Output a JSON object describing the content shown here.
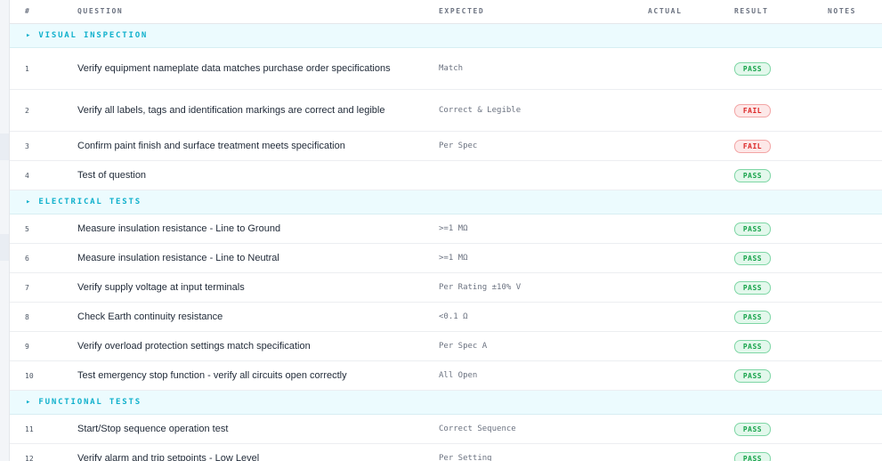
{
  "columns": {
    "num": "#",
    "question": "QUESTION",
    "expected": "EXPECTED",
    "actual": "ACTUAL",
    "result": "RESULT",
    "notes": "NOTES"
  },
  "colors": {
    "section_bg": "#ecfbfe",
    "section_text": "#0fb0cc",
    "pass": "#16a34a",
    "fail": "#dc2626"
  },
  "sections": [
    {
      "title": "▸ VISUAL INSPECTION",
      "rows": [
        {
          "num": "1",
          "question": "Verify equipment nameplate data matches purchase order specifications",
          "expected": "Match",
          "actual": "",
          "result": "PASS",
          "status": "pass",
          "notes": ""
        },
        {
          "num": "2",
          "question": "Verify all labels, tags and identification markings are correct and legible",
          "expected": "Correct & Legible",
          "actual": "",
          "result": "FAIL",
          "status": "fail",
          "notes": ""
        },
        {
          "num": "3",
          "question": "Confirm paint finish and surface treatment meets specification",
          "expected": "Per Spec",
          "actual": "",
          "result": "FAIL",
          "status": "fail",
          "notes": ""
        },
        {
          "num": "4",
          "question": "Test of question",
          "expected": "",
          "actual": "",
          "result": "PASS",
          "status": "pass",
          "notes": ""
        }
      ]
    },
    {
      "title": "▸ ELECTRICAL TESTS",
      "rows": [
        {
          "num": "5",
          "question": "Measure insulation resistance - Line to Ground",
          "expected": ">=1 MΩ",
          "actual": "",
          "result": "PASS",
          "status": "pass",
          "notes": ""
        },
        {
          "num": "6",
          "question": "Measure insulation resistance - Line to Neutral",
          "expected": ">=1 MΩ",
          "actual": "",
          "result": "PASS",
          "status": "pass",
          "notes": ""
        },
        {
          "num": "7",
          "question": "Verify supply voltage at input terminals",
          "expected": "Per Rating ±10% V",
          "actual": "",
          "result": "PASS",
          "status": "pass",
          "notes": ""
        },
        {
          "num": "8",
          "question": "Check Earth continuity resistance",
          "expected": "<0.1 Ω",
          "actual": "",
          "result": "PASS",
          "status": "pass",
          "notes": ""
        },
        {
          "num": "9",
          "question": "Verify overload protection settings match specification",
          "expected": "Per Spec A",
          "actual": "",
          "result": "PASS",
          "status": "pass",
          "notes": ""
        },
        {
          "num": "10",
          "question": "Test emergency stop function - verify all circuits open correctly",
          "expected": "All Open",
          "actual": "",
          "result": "PASS",
          "status": "pass",
          "notes": ""
        }
      ]
    },
    {
      "title": "▸ FUNCTIONAL TESTS",
      "rows": [
        {
          "num": "11",
          "question": "Start/Stop sequence operation test",
          "expected": "Correct Sequence",
          "actual": "",
          "result": "PASS",
          "status": "pass",
          "notes": ""
        },
        {
          "num": "12",
          "question": "Verify alarm and trip setpoints - Low Level",
          "expected": "Per Setting",
          "actual": "",
          "result": "PASS",
          "status": "pass",
          "notes": ""
        }
      ]
    }
  ]
}
